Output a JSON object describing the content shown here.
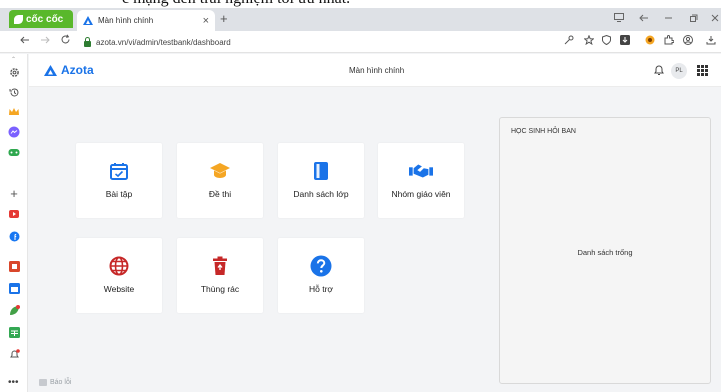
{
  "caption": "c mạng đến trải nghiệm tối ưu nhất.",
  "browser": {
    "brand": "cốc cốc",
    "tab_title": "Màn hình chính",
    "tab_close": "×",
    "new_tab": "+",
    "url": "azota.vn/vi/admin/testbank/dashboard"
  },
  "app": {
    "logo_text": "Azota",
    "title": "Màn hình chính",
    "avatar_initials": "PL"
  },
  "tiles": [
    {
      "label": "Bài tập",
      "icon": "calendar-check-icon",
      "color": "#1a73e8"
    },
    {
      "label": "Đề thi",
      "icon": "graduation-cap-icon",
      "color": "#f5a623"
    },
    {
      "label": "Danh sách lớp",
      "icon": "book-icon",
      "color": "#1a73e8"
    },
    {
      "label": "Nhóm giáo viên",
      "icon": "handshake-icon",
      "color": "#1a73e8"
    },
    {
      "label": "Website",
      "icon": "globe-icon",
      "color": "#c62828"
    },
    {
      "label": "Thùng rác",
      "icon": "trash-icon",
      "color": "#c62828"
    },
    {
      "label": "Hỗ trợ",
      "icon": "help-circle-icon",
      "color": "#1a73e8"
    }
  ],
  "panel": {
    "heading": "HỌC SINH HỎI BAN",
    "empty_text": "Danh sách trống"
  },
  "footer": {
    "report_label": "Báo lỗi",
    "more": "•••"
  },
  "colors": {
    "accent": "#1a73e8",
    "brand_green": "#59b82b"
  }
}
